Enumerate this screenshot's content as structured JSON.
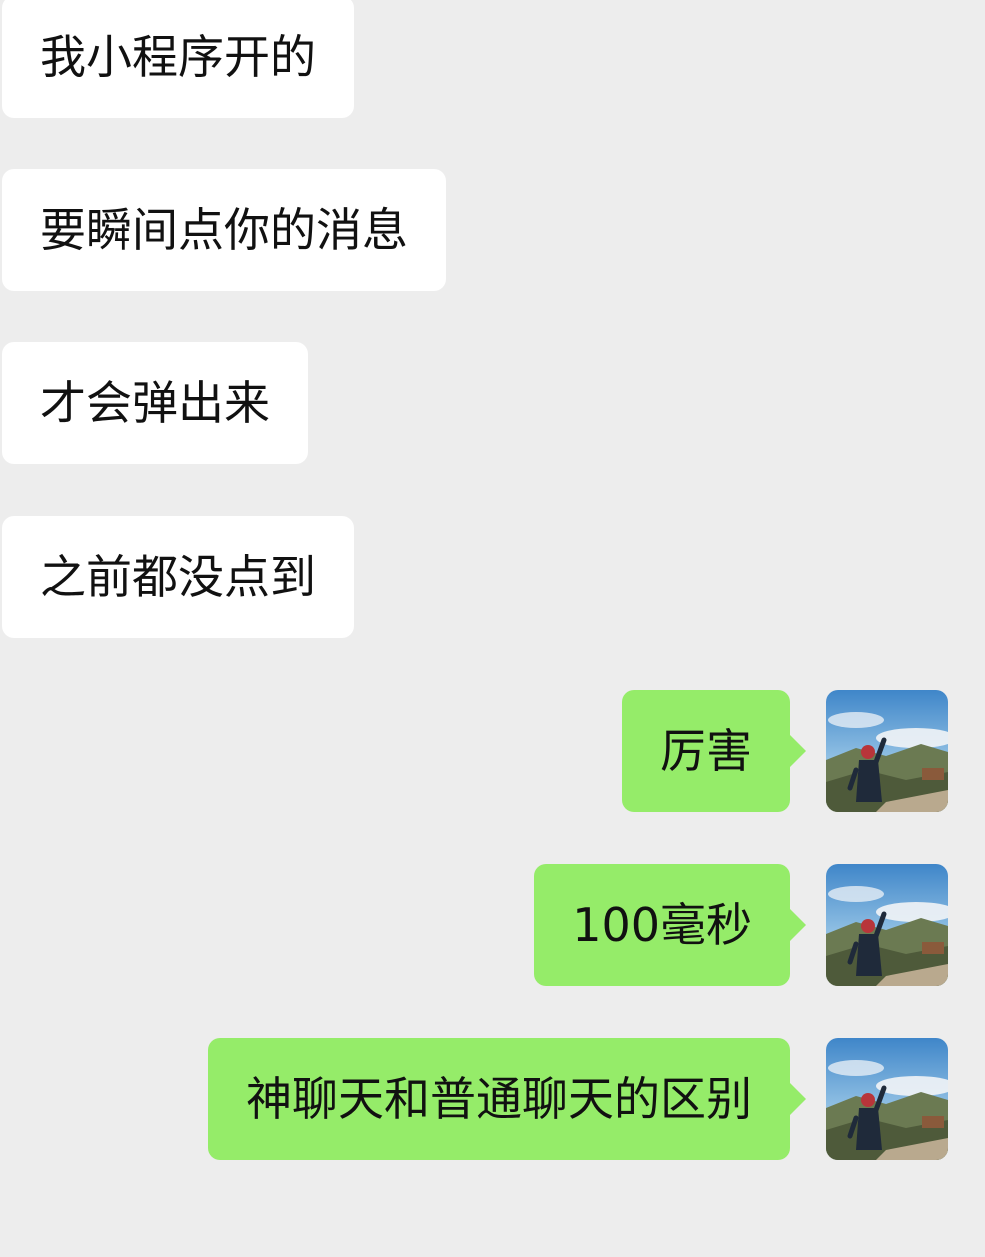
{
  "messages": [
    {
      "side": "in",
      "text": "我小程序开的"
    },
    {
      "side": "in",
      "text": "要瞬间点你的消息"
    },
    {
      "side": "in",
      "text": "才会弹出来"
    },
    {
      "side": "in",
      "text": "之前都没点到"
    },
    {
      "side": "out",
      "text": "厉害",
      "avatar": "user-avatar-photo"
    },
    {
      "side": "out",
      "text": "100毫秒",
      "avatar": "user-avatar-photo"
    },
    {
      "side": "out",
      "text": "神聊天和普通聊天的区别",
      "avatar": "user-avatar-photo"
    }
  ],
  "colors": {
    "background": "#ededed",
    "incoming_bubble": "#ffffff",
    "outgoing_bubble": "#95ec69",
    "text": "#111111"
  }
}
